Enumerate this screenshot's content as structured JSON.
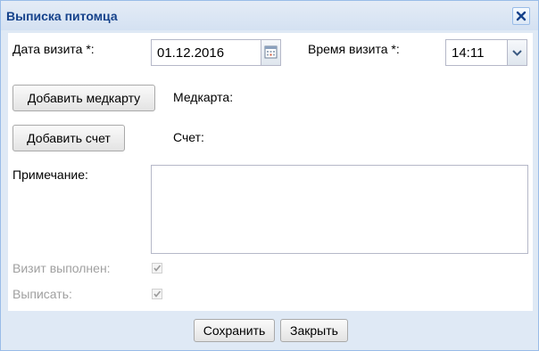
{
  "window": {
    "title": "Выписка питомца"
  },
  "form": {
    "visit_date": {
      "label": "Дата визита *:",
      "value": "01.12.2016"
    },
    "visit_time": {
      "label": "Время визита *:",
      "value": "14:11"
    },
    "add_medcard_label": "Добавить медкарту",
    "medcard_label": "Медкарта:",
    "add_invoice_label": "Добавить счет",
    "invoice_label": "Счет:",
    "note": {
      "label": "Примечание:",
      "value": ""
    },
    "visit_done": {
      "label": "Визит выполнен:",
      "checked": true,
      "disabled": true
    },
    "discharge": {
      "label": "Выписать:",
      "checked": true,
      "disabled": true
    }
  },
  "footer": {
    "save_label": "Сохранить",
    "close_label": "Закрыть"
  },
  "icons": {
    "close": "close-icon",
    "calendar": "calendar-icon",
    "dropdown": "chevron-down-icon",
    "check": "check-icon"
  },
  "colors": {
    "title": "#15428b",
    "border": "#99bce8",
    "frame": "#dfe9f5",
    "disabled_text": "#a0a0a0"
  }
}
